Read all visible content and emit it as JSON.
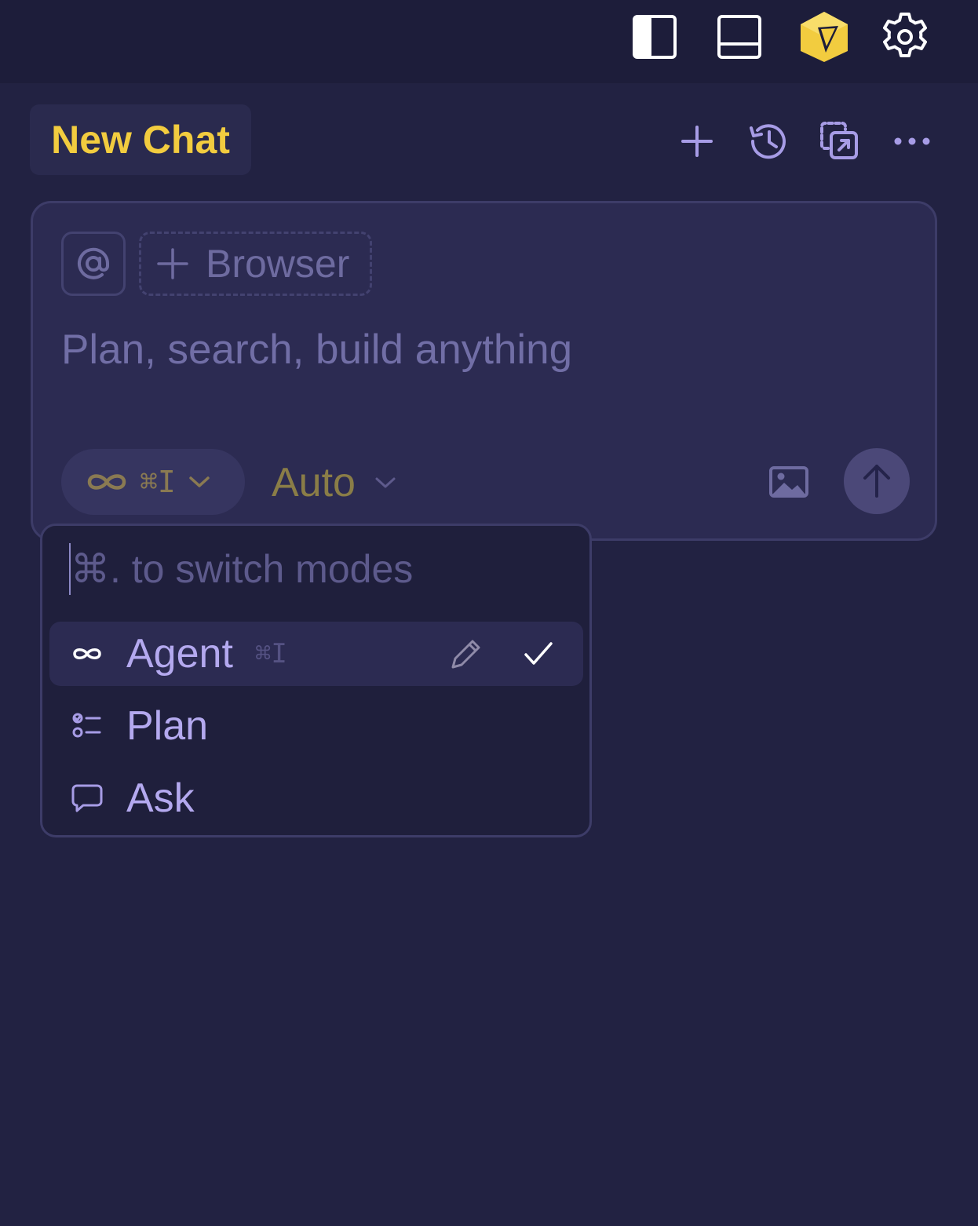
{
  "topbar": {
    "icons": [
      "toggle-sidebar-icon",
      "toggle-panel-icon",
      "cursor-logo-icon",
      "gear-icon"
    ]
  },
  "tabs": [
    {
      "label": "New Chat",
      "active": true
    }
  ],
  "tab_actions": [
    "plus-icon",
    "history-icon",
    "open-in-window-icon",
    "more-icon"
  ],
  "composer": {
    "context_chip_icon": "at-icon",
    "add_context_label": "Browser",
    "placeholder": "Plan, search, build anything",
    "mode_pill": {
      "icon": "infinity-icon",
      "shortcut": "⌘I"
    },
    "model_select": {
      "value": "Auto"
    },
    "attach_image_icon": "image-icon",
    "send_icon": "arrow-up-icon"
  },
  "mode_menu": {
    "search_placeholder": "⌘. to switch modes",
    "items": [
      {
        "label": "Agent",
        "icon": "infinity-icon",
        "shortcut": "⌘I",
        "selected": true
      },
      {
        "label": "Plan",
        "icon": "checklist-icon",
        "shortcut": "",
        "selected": false
      },
      {
        "label": "Ask",
        "icon": "chat-bubble-icon",
        "shortcut": "",
        "selected": false
      }
    ]
  },
  "colors": {
    "background": "#222242",
    "topbar": "#1d1d3a",
    "accent_yellow": "#f2cc3f",
    "accent_purple": "#b4a9ef",
    "composer_bg": "#2c2b52"
  }
}
